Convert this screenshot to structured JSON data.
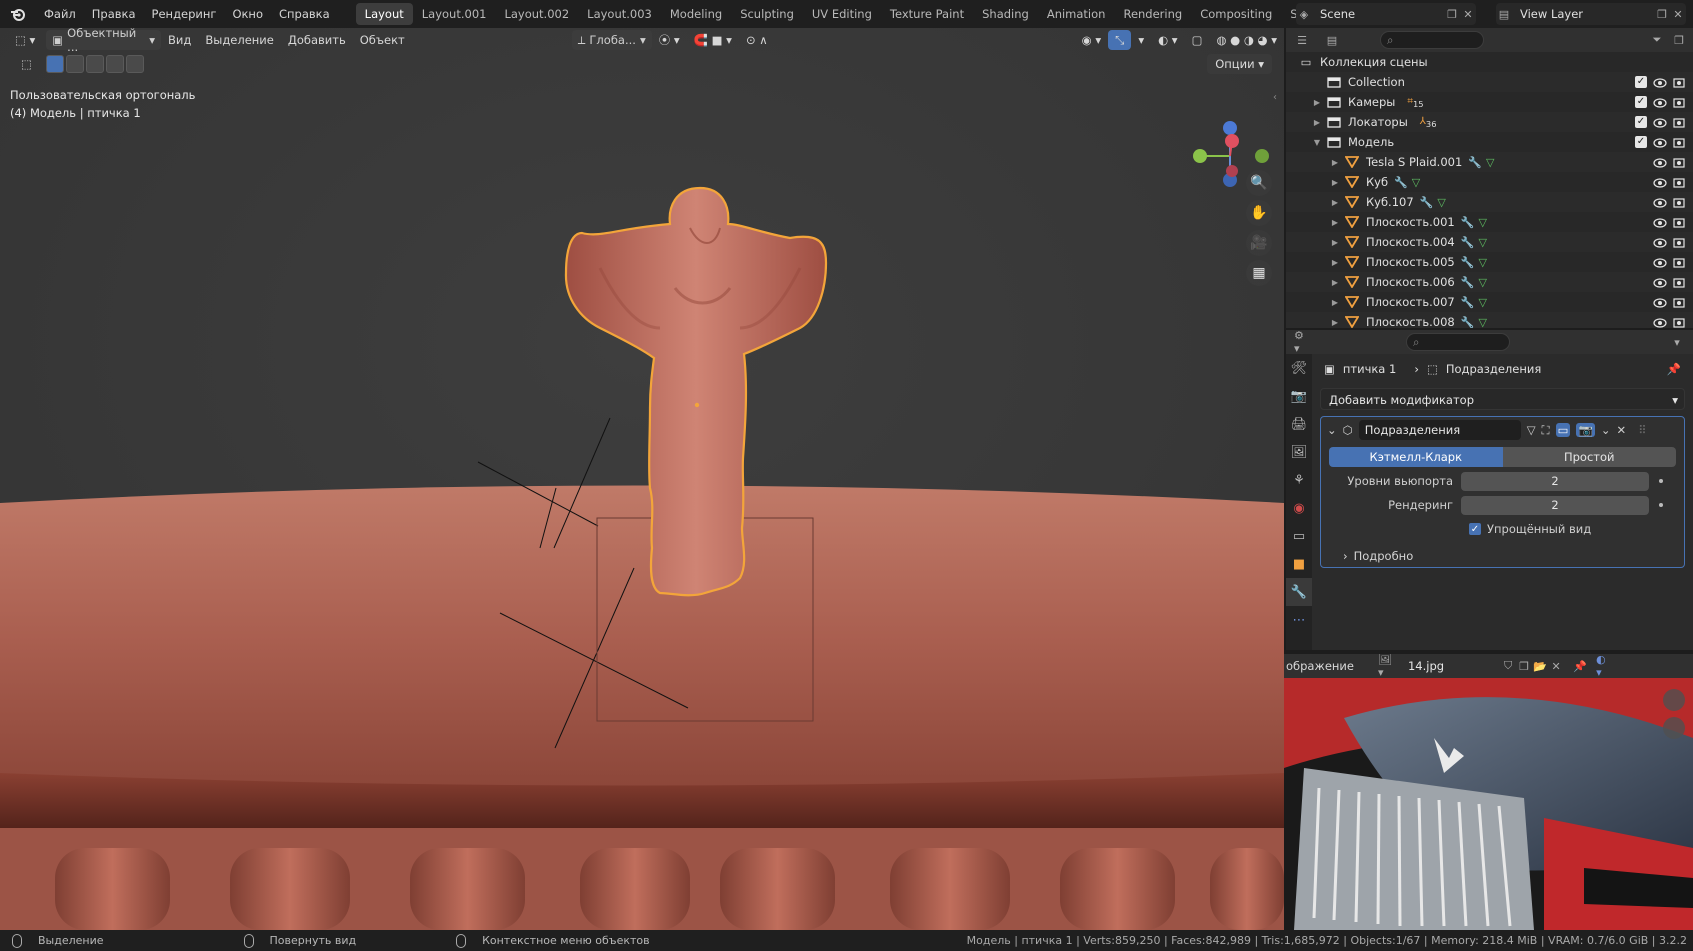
{
  "menu": [
    "Файл",
    "Правка",
    "Рендеринг",
    "Окно",
    "Справка"
  ],
  "workspaces": [
    {
      "label": "Layout",
      "active": true
    },
    {
      "label": "Layout.001",
      "active": false
    },
    {
      "label": "Layout.002",
      "active": false
    },
    {
      "label": "Layout.003",
      "active": false
    },
    {
      "label": "Modeling",
      "active": false
    },
    {
      "label": "Sculpting",
      "active": false
    },
    {
      "label": "UV Editing",
      "active": false
    },
    {
      "label": "Texture Paint",
      "active": false
    },
    {
      "label": "Shading",
      "active": false
    },
    {
      "label": "Animation",
      "active": false
    },
    {
      "label": "Rendering",
      "active": false
    },
    {
      "label": "Compositing",
      "active": false
    },
    {
      "label": "Scripting",
      "active": false
    }
  ],
  "scene": "Scene",
  "view_layer": "View Layer",
  "viewport": {
    "mode": "Объектный ...",
    "menus": [
      "Вид",
      "Выделение",
      "Добавить",
      "Объект"
    ],
    "orientation": "Глоба...",
    "view_name": "Пользовательская ортогональ",
    "object_info": "(4) Модель | птичка 1",
    "options": "Опции"
  },
  "outliner": {
    "root": "Коллекция сцены",
    "rows": [
      {
        "name": "Collection",
        "type": "collection",
        "expand": "",
        "indent": 1,
        "badge": ""
      },
      {
        "name": "Камеры",
        "type": "collection",
        "expand": "▶",
        "indent": 1,
        "badge": "15"
      },
      {
        "name": "Локаторы",
        "type": "collection",
        "expand": "▶",
        "indent": 1,
        "badge": "36"
      },
      {
        "name": "Модель",
        "type": "collection",
        "expand": "▼",
        "indent": 1,
        "badge": ""
      },
      {
        "name": "Tesla S Plaid.001",
        "type": "mesh",
        "expand": "▶",
        "indent": 2,
        "badge": ""
      },
      {
        "name": "Куб",
        "type": "mesh",
        "expand": "▶",
        "indent": 2,
        "badge": ""
      },
      {
        "name": "Куб.107",
        "type": "mesh",
        "expand": "▶",
        "indent": 2,
        "badge": ""
      },
      {
        "name": "Плоскость.001",
        "type": "mesh",
        "expand": "▶",
        "indent": 2,
        "badge": ""
      },
      {
        "name": "Плоскость.004",
        "type": "mesh",
        "expand": "▶",
        "indent": 2,
        "badge": ""
      },
      {
        "name": "Плоскость.005",
        "type": "mesh",
        "expand": "▶",
        "indent": 2,
        "badge": ""
      },
      {
        "name": "Плоскость.006",
        "type": "mesh",
        "expand": "▶",
        "indent": 2,
        "badge": ""
      },
      {
        "name": "Плоскость.007",
        "type": "mesh",
        "expand": "▶",
        "indent": 2,
        "badge": ""
      },
      {
        "name": "Плоскость.008",
        "type": "mesh",
        "expand": "▶",
        "indent": 2,
        "badge": ""
      }
    ]
  },
  "properties": {
    "object": "птичка 1",
    "modifier_crumb": "Подразделения",
    "add_modifier": "Добавить модификатор",
    "modifier": {
      "name": "Подразделения",
      "type_on": "Кэтмелл-Кларк",
      "type_off": "Простой",
      "viewport_label": "Уровни вьюпорта",
      "viewport_value": "2",
      "render_label": "Рендеринг",
      "render_value": "2",
      "optimal_label": "Упрощённый вид",
      "optimal_checked": true,
      "advanced_label": "Подробно"
    }
  },
  "image_editor": {
    "label": "ображение",
    "image_name": "14.jpg"
  },
  "status": {
    "left1": "Выделение",
    "left2": "Повернуть вид",
    "left3": "Контекстное меню объектов",
    "stats": "Модель | птичка 1 | Verts:859,250 | Faces:842,989 | Tris:1,685,972 | Objects:1/67 | Memory: 218.4 MiB | VRAM: 0.7/6.0 GiB | 3.2.2"
  },
  "colors": {
    "accent": "#4772b3",
    "selection_outline": "#f3a53a",
    "model": "#b96a5a",
    "viewport_bg": "#393939"
  }
}
